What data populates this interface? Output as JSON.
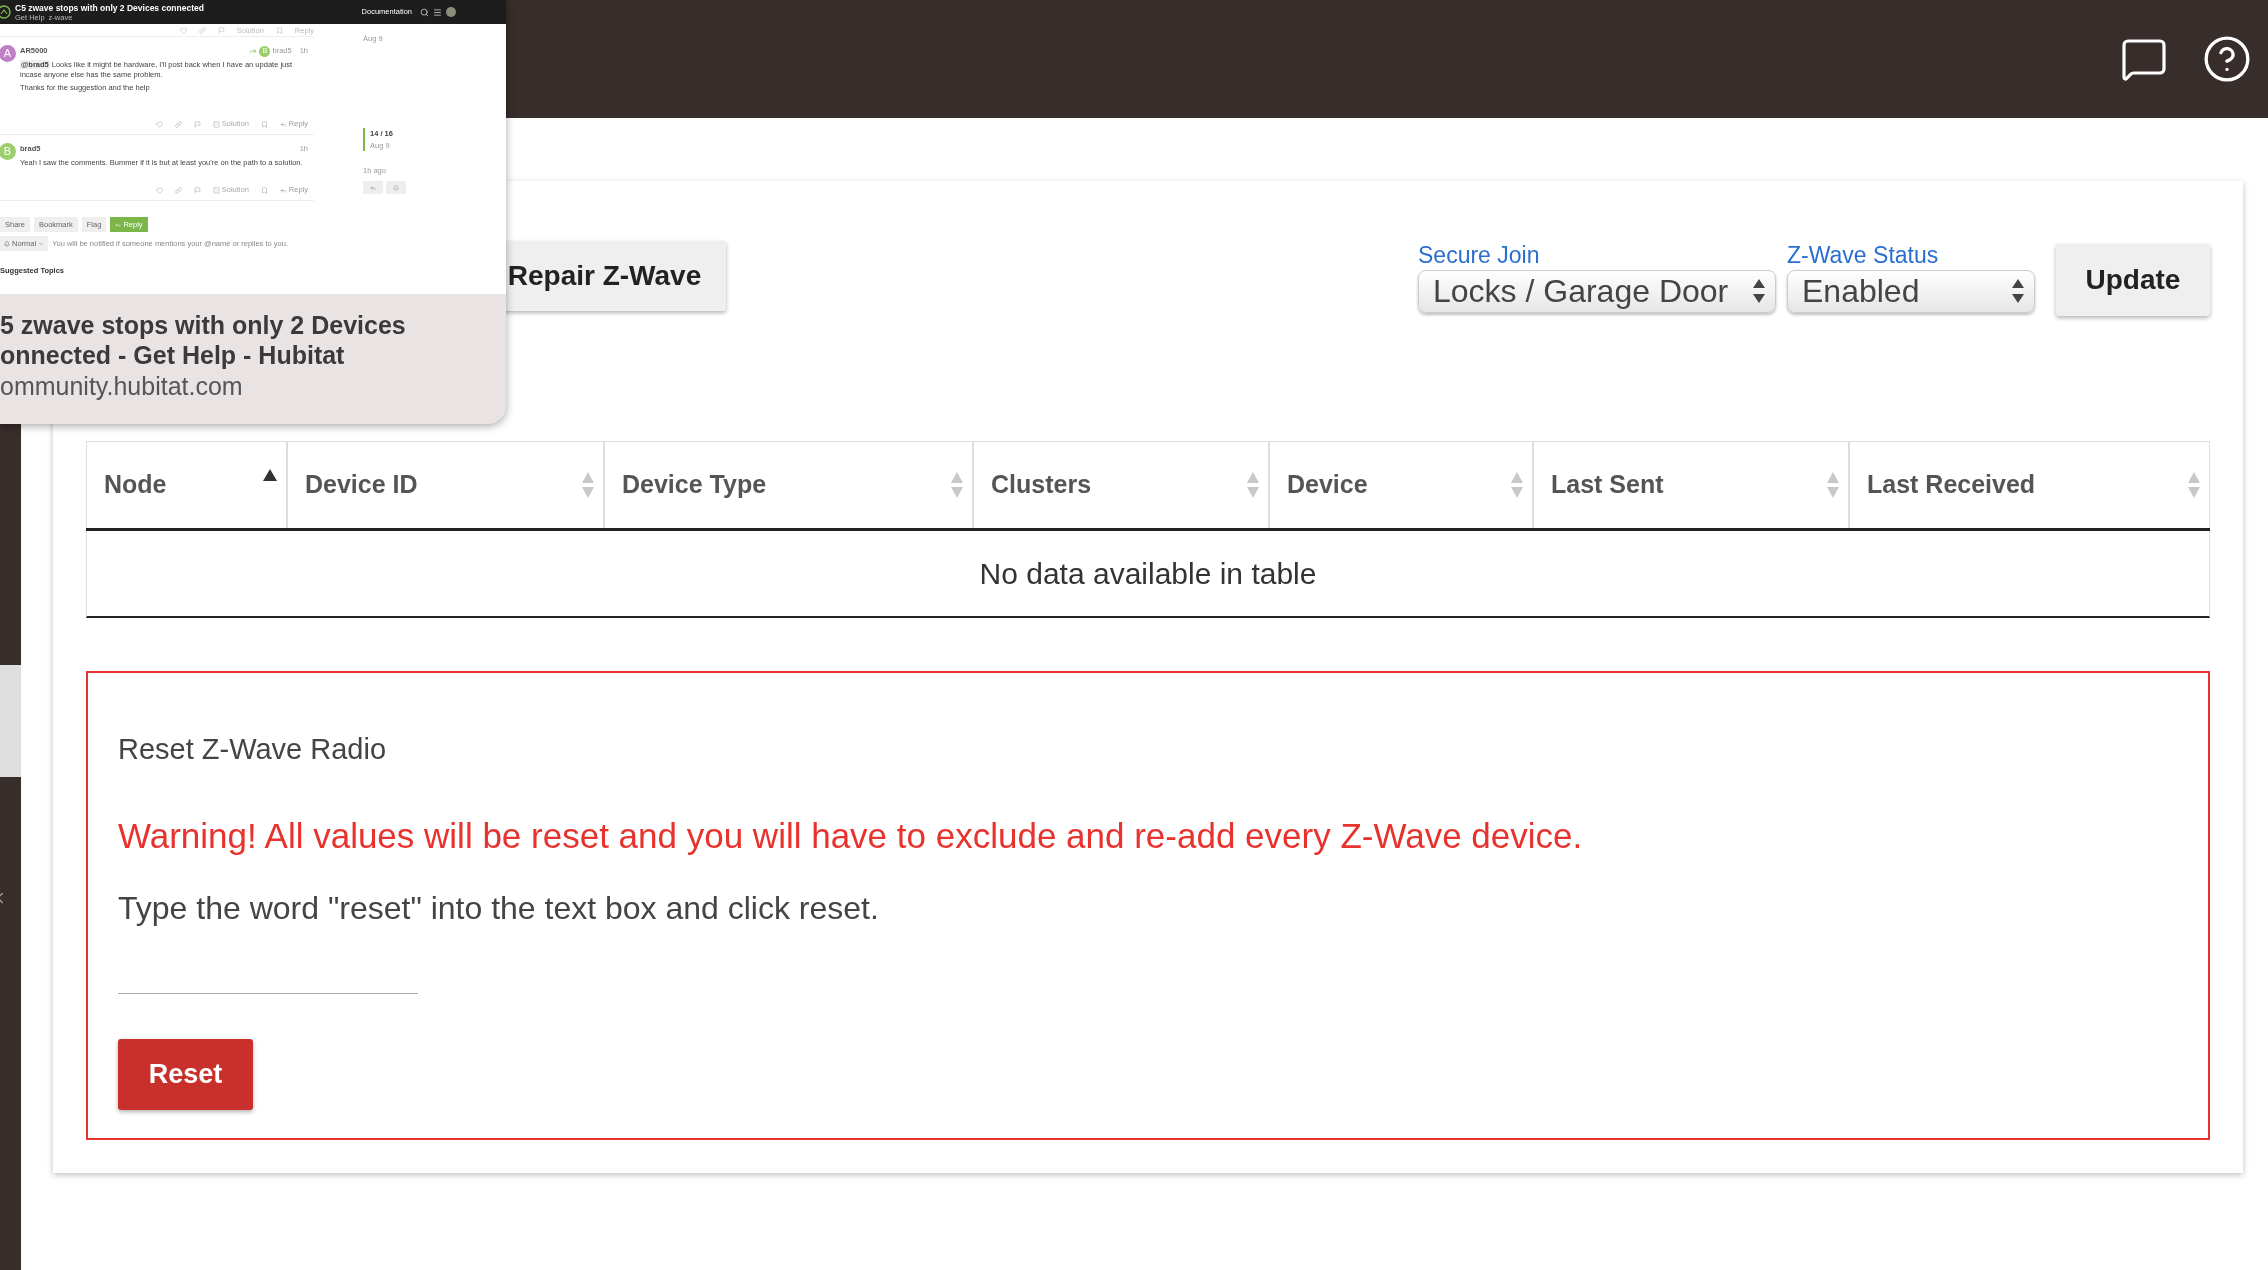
{
  "tab_preview": {
    "thumbnail": {
      "title": "C5 zwave stops with only 2 Devices connected",
      "category": "Get Help",
      "tag": "z-wave",
      "nav_link": "Documentation",
      "top_actions": [
        "Solution",
        "Reply"
      ],
      "posts": [
        {
          "author": "AR5000",
          "letter": "A",
          "color": "#c27fc9",
          "reply_to": {
            "name": "brad5",
            "letter": "B",
            "color": "#9ccf6c"
          },
          "time": "1h",
          "mention": "@brad5",
          "paragraphs": [
            "Looks like it might be hardware, I'll post back when I have an update just incase anyone else has the same problem.",
            "Thanks for the suggestion and the help"
          ],
          "actions": [
            "Solution",
            "Reply"
          ]
        },
        {
          "author": "brad5",
          "letter": "B",
          "color": "#9ccf6c",
          "time": "1h",
          "paragraphs": [
            "Yeah I saw the comments. Bummer if it is but at least you're on the path to a solution."
          ],
          "actions": [
            "Solution",
            "Reply"
          ]
        }
      ],
      "timeline": {
        "date_top": "Aug 9",
        "position": "14 / 16",
        "date": "Aug 9",
        "age": "1h ago"
      },
      "footer_buttons": [
        {
          "label": "Share",
          "kind": "plain"
        },
        {
          "label": "Bookmark",
          "kind": "plain"
        },
        {
          "label": "Flag",
          "kind": "plain"
        },
        {
          "label": "Reply",
          "kind": "primary"
        }
      ],
      "notification": {
        "level": "Normal",
        "text": "You will be notified if someone mentions your @name or replies to you."
      },
      "suggested_heading": "Suggested Topics"
    },
    "title_lines": [
      "5 zwave stops with only 2 Devices",
      "onnected - Get Help - Hubitat"
    ],
    "url": "ommunity.hubitat.com"
  },
  "controls": {
    "repair_button": "Repair Z-Wave",
    "secure_join": {
      "label": "Secure Join",
      "value": "Locks / Garage Door"
    },
    "zwave_status": {
      "label": "Z-Wave Status",
      "value": "Enabled"
    },
    "update_button": "Update"
  },
  "table": {
    "columns": [
      {
        "label": "Node",
        "sorted": true
      },
      {
        "label": "Device ID",
        "sorted": false
      },
      {
        "label": "Device Type",
        "sorted": false
      },
      {
        "label": "Clusters",
        "sorted": false
      },
      {
        "label": "Device",
        "sorted": false
      },
      {
        "label": "Last Sent",
        "sorted": false
      },
      {
        "label": "Last Received",
        "sorted": false
      }
    ],
    "empty_message": "No data available in table"
  },
  "reset_panel": {
    "title": "Reset Z-Wave Radio",
    "warning": "Warning! All values will be reset and you will have to exclude and re-add every Z-Wave device.",
    "instruction": "Type the word \"reset\" into the text box and click reset.",
    "button": "Reset"
  }
}
